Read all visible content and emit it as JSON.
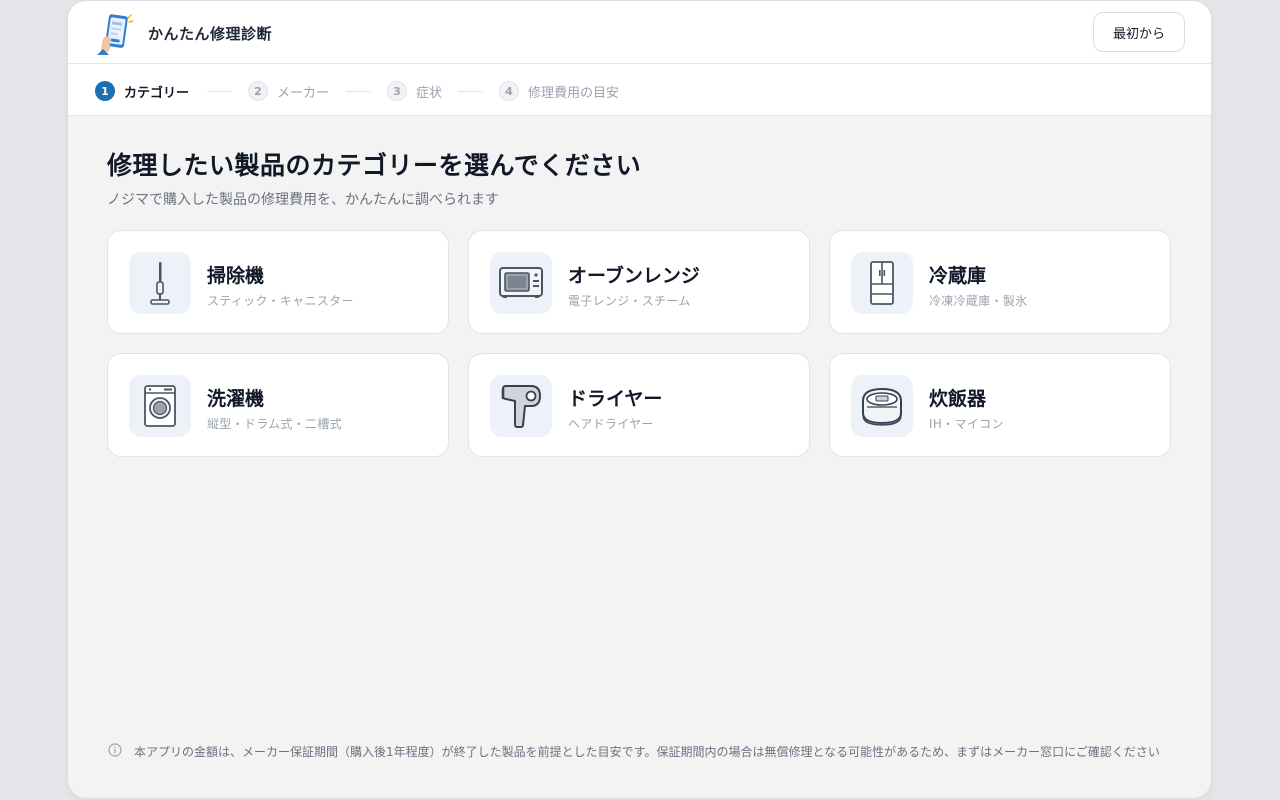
{
  "header": {
    "app_title": "かんたん修理診断",
    "restart_label": "最初から",
    "logo_icon": "phone-app-logo-icon"
  },
  "stepper": {
    "active_color": "#1c6fb0",
    "steps": [
      {
        "number": "1",
        "label": "カテゴリー",
        "state": "active"
      },
      {
        "number": "2",
        "label": "メーカー",
        "state": "inactive"
      },
      {
        "number": "3",
        "label": "症状",
        "state": "inactive"
      },
      {
        "number": "4",
        "label": "修理費用の目安",
        "state": "inactive"
      }
    ]
  },
  "main": {
    "title": "修理したい製品のカテゴリーを選んでください",
    "subtitle": "ノジマで購入した製品の修理費用を、かんたんに調べられます"
  },
  "categories": [
    {
      "title": "掃除機",
      "subtitle": "スティック・キャニスター",
      "icon": "vacuum-cleaner-icon"
    },
    {
      "title": "オーブンレンジ",
      "subtitle": "電子レンジ・スチーム",
      "icon": "microwave-oven-icon"
    },
    {
      "title": "冷蔵庫",
      "subtitle": "冷凍冷蔵庫・製氷",
      "icon": "refrigerator-icon"
    },
    {
      "title": "洗濯機",
      "subtitle": "縦型・ドラム式・二槽式",
      "icon": "washing-machine-icon"
    },
    {
      "title": "ドライヤー",
      "subtitle": "ヘアドライヤー",
      "icon": "hair-dryer-icon"
    },
    {
      "title": "炊飯器",
      "subtitle": "IH・マイコン",
      "icon": "rice-cooker-icon"
    }
  ],
  "footnote": {
    "icon": "info-icon",
    "text": "本アプリの金額は、メーカー保証期間（購入後1年程度）が終了した製品を前提とした目安です。保証期間内の場合は無償修理となる可能性があるため、まずはメーカー窓口にご確認ください"
  }
}
